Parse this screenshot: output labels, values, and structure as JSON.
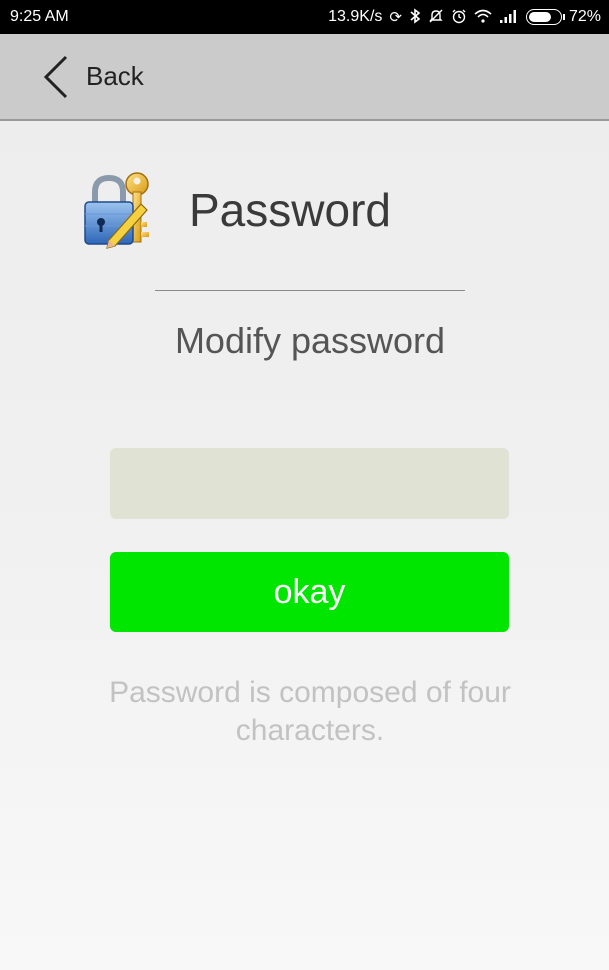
{
  "status_bar": {
    "time": "9:25 AM",
    "net_speed": "13.9K/s",
    "battery": "72%",
    "battery_level": 0.72,
    "icons": [
      "sync-icon",
      "bluetooth-icon",
      "mute-icon",
      "alarm-icon",
      "wifi-icon",
      "signal-icon",
      "battery-icon"
    ]
  },
  "nav": {
    "back_label": "Back"
  },
  "header": {
    "title": "Password",
    "icon": "lock-key-icon"
  },
  "form": {
    "subtitle": "Modify password",
    "password_value": "",
    "password_placeholder": "",
    "submit_label": "okay",
    "hint": "Password is composed of four characters."
  },
  "colors": {
    "nav_bg": "#cbcbcb",
    "button_bg": "#00e600",
    "input_bg": "#e0e2d3",
    "hint_text": "#c2c2c2"
  }
}
